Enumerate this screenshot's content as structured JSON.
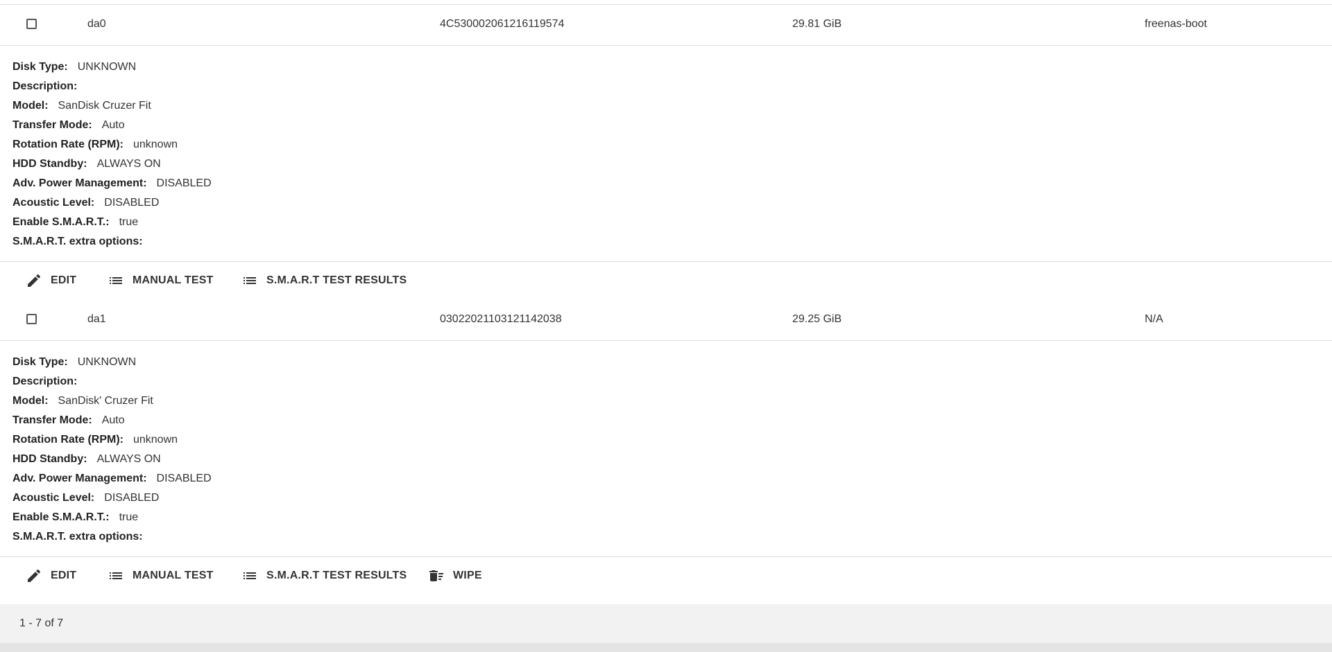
{
  "disks": [
    {
      "name": "da0",
      "serial": "4C530002061216119574",
      "size": "29.81 GiB",
      "pool": "freenas-boot",
      "details": [
        {
          "label": "Disk Type:",
          "value": "UNKNOWN"
        },
        {
          "label": "Description:",
          "value": ""
        },
        {
          "label": "Model:",
          "value": "SanDisk Cruzer Fit"
        },
        {
          "label": "Transfer Mode:",
          "value": "Auto"
        },
        {
          "label": "Rotation Rate (RPM):",
          "value": "unknown"
        },
        {
          "label": "HDD Standby:",
          "value": "ALWAYS ON"
        },
        {
          "label": "Adv. Power Management:",
          "value": "DISABLED"
        },
        {
          "label": "Acoustic Level:",
          "value": "DISABLED"
        },
        {
          "label": "Enable S.M.A.R.T.:",
          "value": "true"
        },
        {
          "label": "S.M.A.R.T. extra options:",
          "value": ""
        }
      ],
      "actions": [
        {
          "label": "EDIT",
          "icon": "pencil-icon"
        },
        {
          "label": "MANUAL TEST",
          "icon": "list-icon"
        },
        {
          "label": "S.M.A.R.T TEST RESULTS",
          "icon": "list-icon"
        }
      ]
    },
    {
      "name": "da1",
      "serial": "03022021103121142038",
      "size": "29.25 GiB",
      "pool": "N/A",
      "details": [
        {
          "label": "Disk Type:",
          "value": "UNKNOWN"
        },
        {
          "label": "Description:",
          "value": ""
        },
        {
          "label": "Model:",
          "value": "SanDisk' Cruzer Fit"
        },
        {
          "label": "Transfer Mode:",
          "value": "Auto"
        },
        {
          "label": "Rotation Rate (RPM):",
          "value": "unknown"
        },
        {
          "label": "HDD Standby:",
          "value": "ALWAYS ON"
        },
        {
          "label": "Adv. Power Management:",
          "value": "DISABLED"
        },
        {
          "label": "Acoustic Level:",
          "value": "DISABLED"
        },
        {
          "label": "Enable S.M.A.R.T.:",
          "value": "true"
        },
        {
          "label": "S.M.A.R.T. extra options:",
          "value": ""
        }
      ],
      "actions": [
        {
          "label": "EDIT",
          "icon": "pencil-icon"
        },
        {
          "label": "MANUAL TEST",
          "icon": "list-icon"
        },
        {
          "label": "S.M.A.R.T TEST RESULTS",
          "icon": "list-icon"
        },
        {
          "label": "WIPE",
          "icon": "delete-sweep-icon"
        }
      ]
    }
  ],
  "pagination": {
    "range": "1 - 7 of 7"
  }
}
